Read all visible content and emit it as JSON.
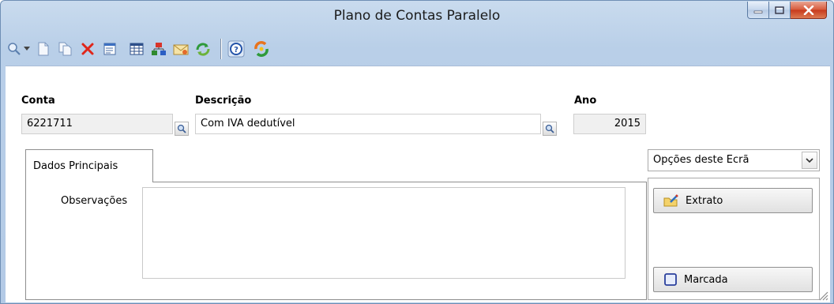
{
  "window": {
    "title": "Plano de Contas Paralelo"
  },
  "toolbar": {
    "buttons": [
      "search-icon",
      "dropdown-arrow-icon",
      "new-document-icon",
      "copy-icon",
      "delete-icon",
      "properties-icon",
      "table-icon",
      "hierarchy-icon",
      "envelope-icon",
      "refresh-icon",
      "help-icon",
      "sync-icon"
    ]
  },
  "form": {
    "conta_label": "Conta",
    "conta_value": "6221711",
    "descricao_label": "Descrição",
    "descricao_value": "Com IVA dedutível",
    "ano_label": "Ano",
    "ano_value": "2015"
  },
  "tabs": {
    "active_label": "Dados Principais"
  },
  "dados": {
    "observacoes_label": "Observações",
    "observacoes_value": ""
  },
  "opcoes": {
    "title": "Opções deste Ecrã",
    "extrato_label": "Extrato",
    "marcada_label": "Marcada"
  },
  "colors": {
    "titlebar": "#b9cfe8",
    "close_button": "#c7391b",
    "border": "#8e8e8e"
  }
}
